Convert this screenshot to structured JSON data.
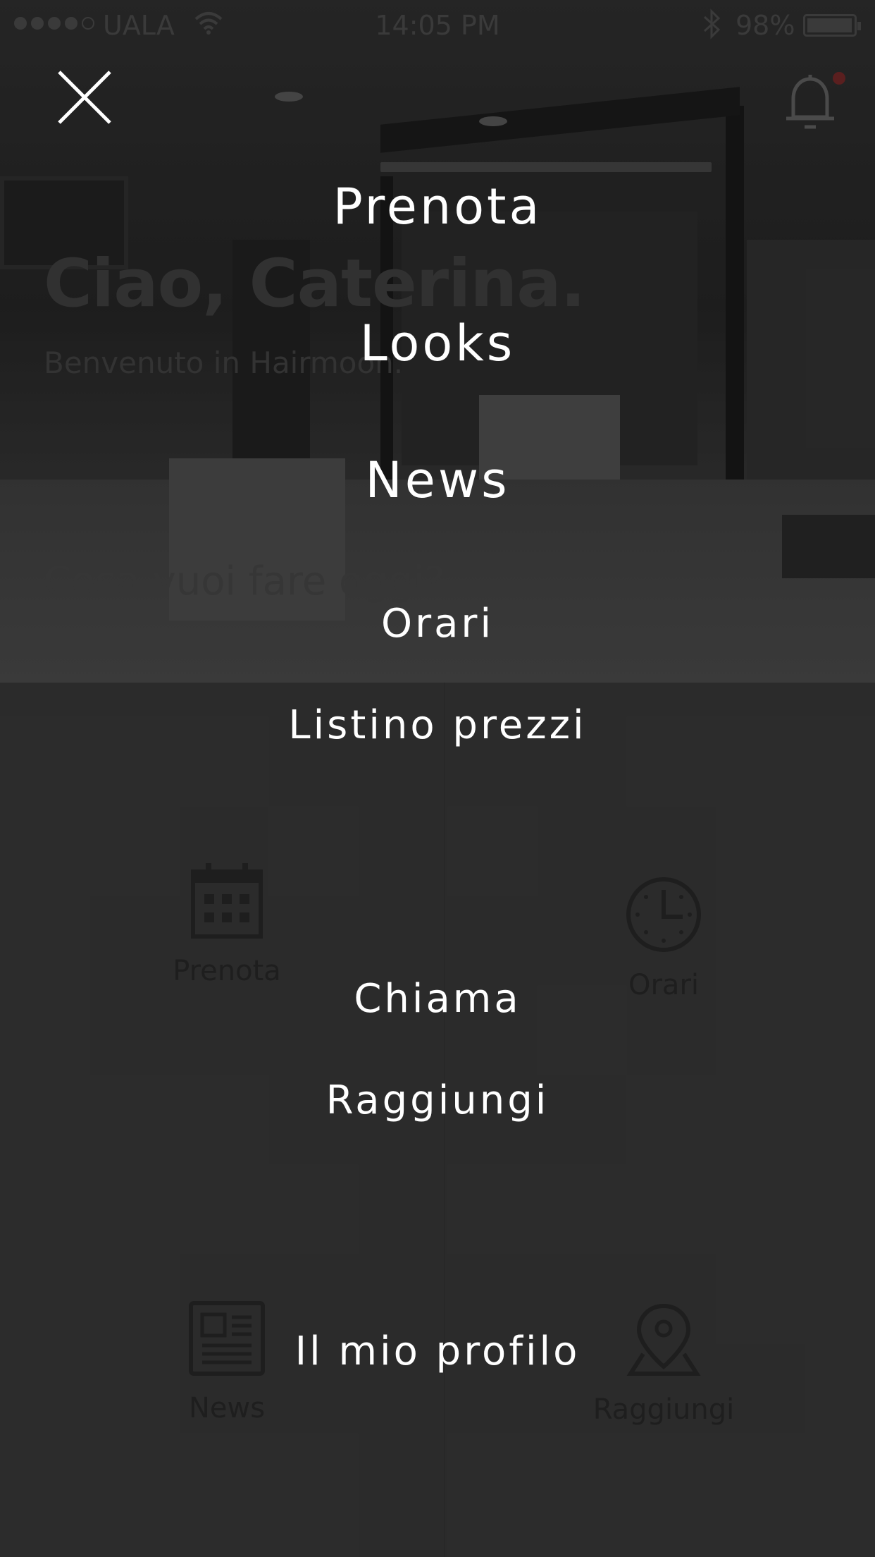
{
  "status_bar": {
    "carrier": "UALA",
    "time": "14:05 PM",
    "battery_percent": "98%",
    "battery_level": 0.98,
    "signal_bars": 4
  },
  "background": {
    "greeting": "Ciao, Caterina.",
    "welcome": "Benvenuto in Hairmoon.",
    "question": "Cosa vuoi fare oggi?",
    "grid": [
      {
        "label": "Prenota",
        "icon": "calendar-icon"
      },
      {
        "label": "Orari",
        "icon": "clock-icon"
      },
      {
        "label": "News",
        "icon": "newspaper-icon"
      },
      {
        "label": "Raggiungi",
        "icon": "map-pin-icon"
      }
    ]
  },
  "menu": {
    "close_icon": "close-icon",
    "notification_icon": "bell-icon",
    "items": [
      "Prenota",
      "Looks",
      "News",
      "Orari",
      "Listino prezzi",
      "Chiama",
      "Raggiungi",
      "Il mio profilo"
    ]
  },
  "colors": {
    "menu_text": "#ffffff",
    "background": "#333333",
    "notification_dot": "#5a1f1f"
  }
}
